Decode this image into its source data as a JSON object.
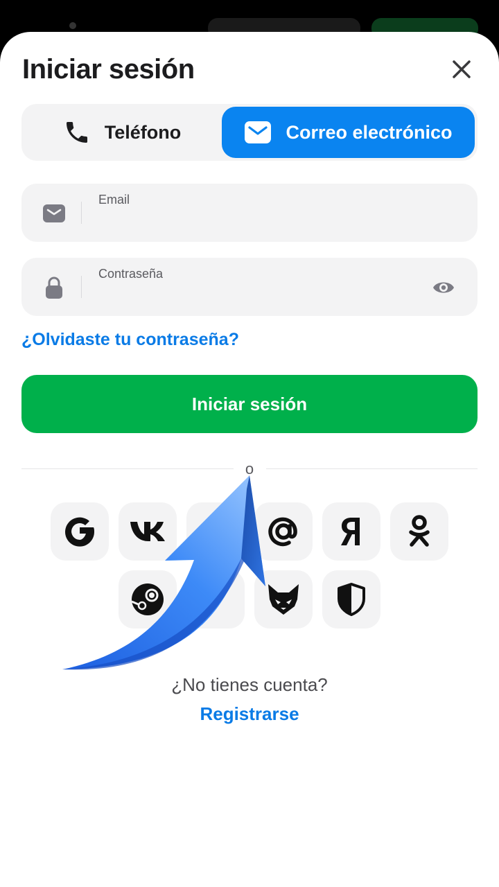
{
  "header": {
    "title": "Iniciar sesión"
  },
  "tabs": [
    {
      "label": "Teléfono",
      "icon": "phone-icon",
      "active": false
    },
    {
      "label": "Correo electrónico",
      "icon": "envelope-icon",
      "active": true
    }
  ],
  "email_field": {
    "label": "Email",
    "value": ""
  },
  "password_field": {
    "label": "Contraseña",
    "value": ""
  },
  "forgot_link": "¿Olvidaste tu contraseña?",
  "login_button": "Iniciar sesión",
  "divider_text": "o",
  "social_providers": [
    {
      "name": "Google",
      "icon": "google-icon"
    },
    {
      "name": "VK",
      "icon": "vk-icon"
    },
    {
      "name": "Mail.ru",
      "icon": "at-sign-icon"
    },
    {
      "name": "Yandex",
      "icon": "yandex-icon"
    },
    {
      "name": "Odnoklassniki",
      "icon": "ok-icon"
    },
    {
      "name": "Steam",
      "icon": "steam-icon"
    },
    {
      "name": "MetaMask",
      "icon": "fox-icon"
    },
    {
      "name": "Shield",
      "icon": "shield-icon"
    }
  ],
  "footer": {
    "question": "¿No tienes cuenta?",
    "register_link": "Registrarse"
  },
  "colors": {
    "accent_blue": "#0a84f0",
    "link_blue": "#0a7be6",
    "primary_green": "#00b04b",
    "field_bg": "#f3f3f4",
    "arrow_blue": "#3d8af7"
  }
}
